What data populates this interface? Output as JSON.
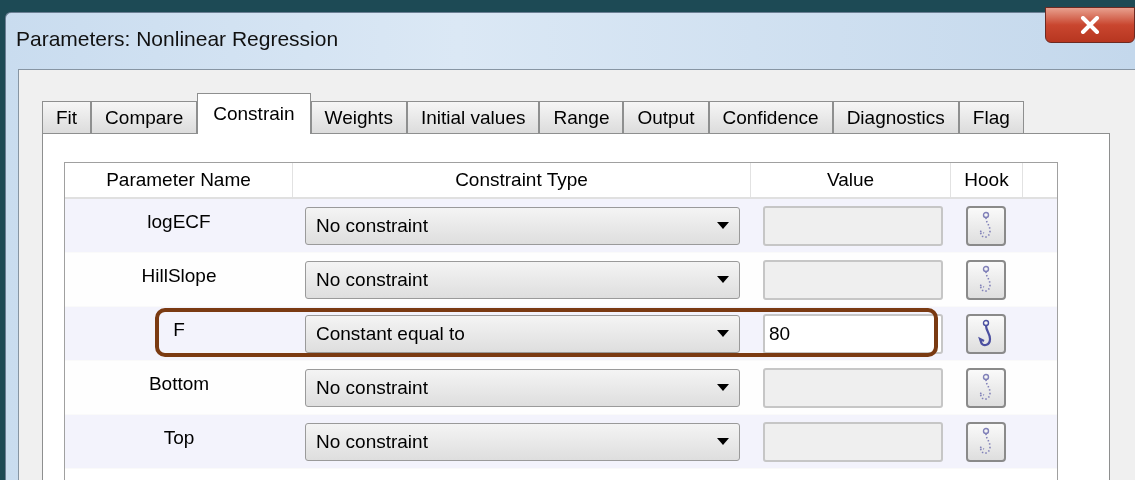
{
  "window": {
    "title": "Parameters: Nonlinear Regression"
  },
  "tabs": [
    {
      "label": "Fit",
      "selected": false
    },
    {
      "label": "Compare",
      "selected": false
    },
    {
      "label": "Constrain",
      "selected": true
    },
    {
      "label": "Weights",
      "selected": false
    },
    {
      "label": "Initial values",
      "selected": false
    },
    {
      "label": "Range",
      "selected": false
    },
    {
      "label": "Output",
      "selected": false
    },
    {
      "label": "Confidence",
      "selected": false
    },
    {
      "label": "Diagnostics",
      "selected": false
    },
    {
      "label": "Flag",
      "selected": false
    }
  ],
  "table": {
    "columns": [
      "Parameter Name",
      "Constraint Type",
      "Value",
      "Hook"
    ],
    "rows": [
      {
        "name": "logECF",
        "constraint": "No constraint",
        "value_disabled": true,
        "hook_active": false,
        "highlighted": false
      },
      {
        "name": "HillSlope",
        "constraint": "No constraint",
        "value_disabled": true,
        "hook_active": false,
        "highlighted": false
      },
      {
        "name": "F",
        "constraint": "Constant equal to",
        "value": "80",
        "value_disabled": false,
        "hook_active": true,
        "highlighted": true
      },
      {
        "name": "Bottom",
        "constraint": "No constraint",
        "value_disabled": true,
        "hook_active": false,
        "highlighted": false
      },
      {
        "name": "Top",
        "constraint": "No constraint",
        "value_disabled": true,
        "hook_active": false,
        "highlighted": false
      }
    ]
  }
}
